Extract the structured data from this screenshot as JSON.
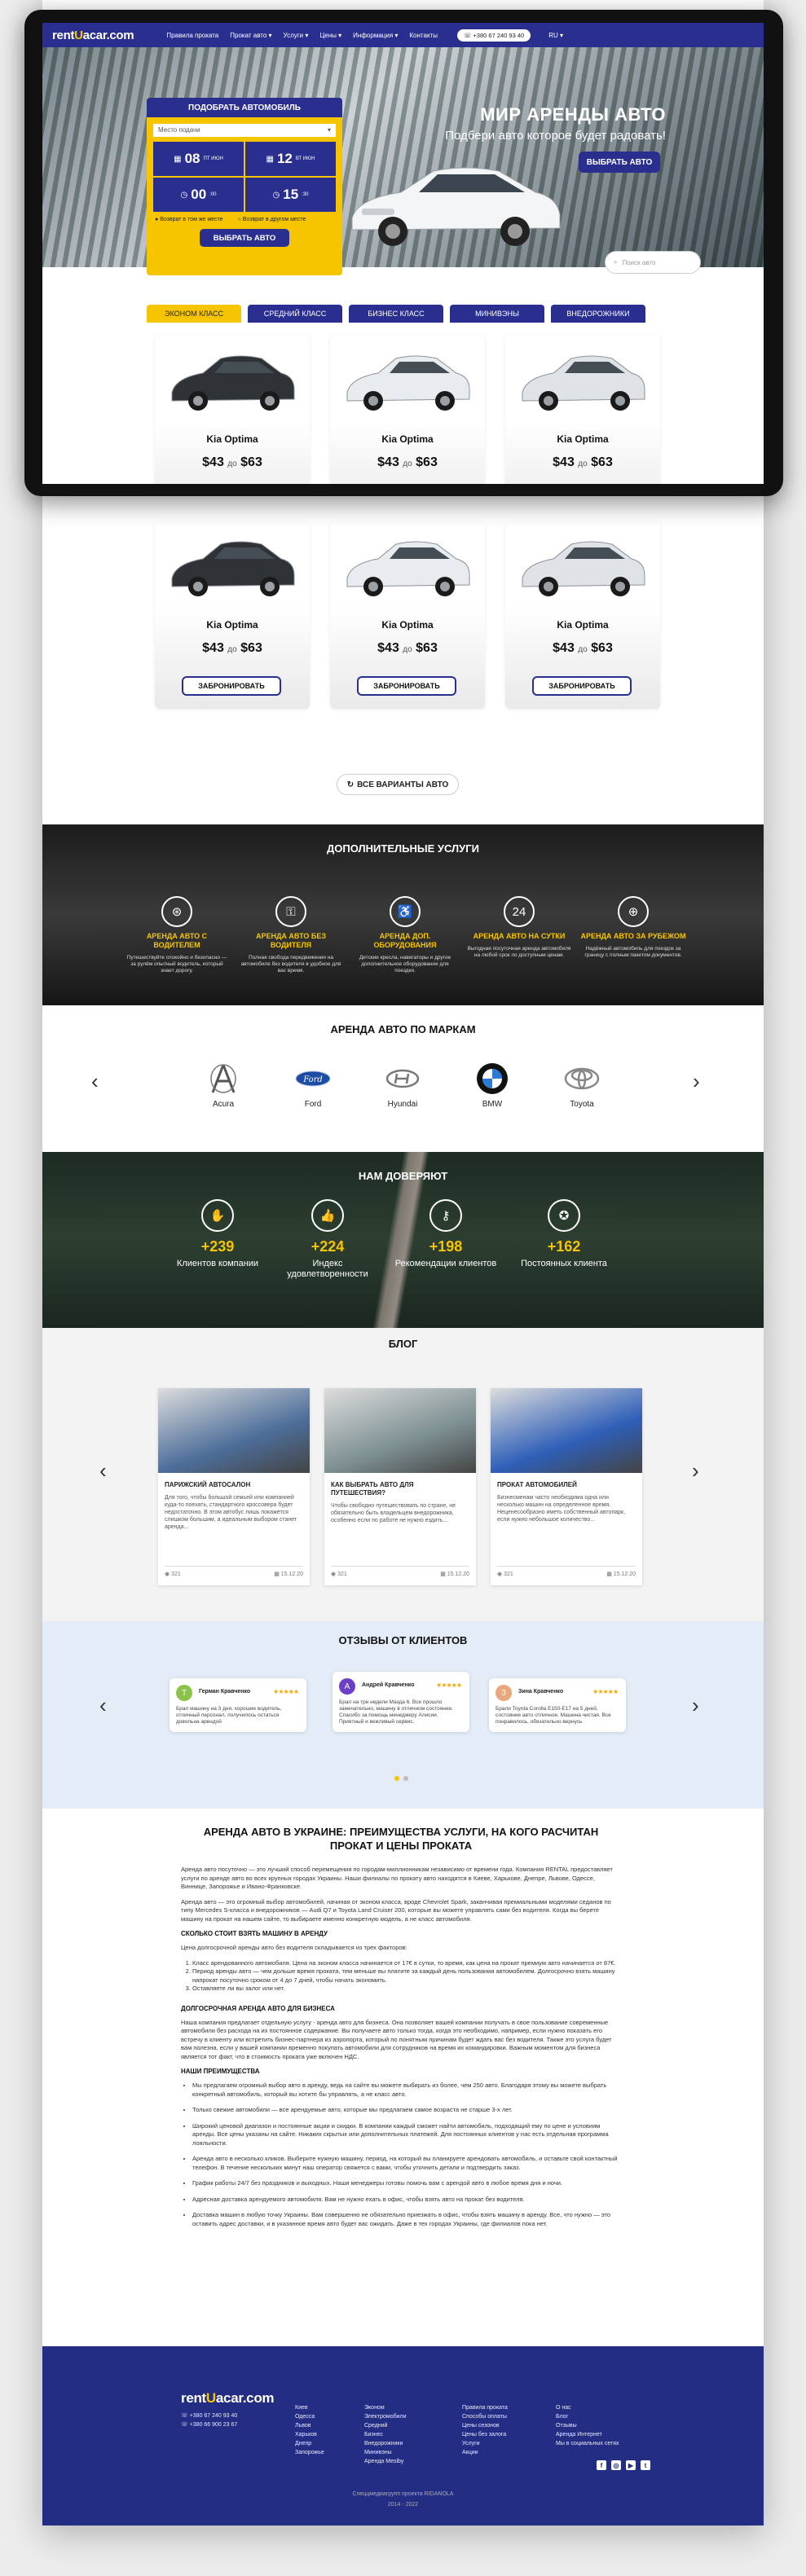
{
  "nav": {
    "logo_a": "rent",
    "logo_u": "U",
    "logo_b": "acar.com",
    "items": [
      "Правила проката",
      "Прокат авто ▾",
      "Услуги ▾",
      "Цены ▾",
      "Информация ▾",
      "Контакты"
    ],
    "phone": "+380 67 240 93 40",
    "lang": "RU ▾"
  },
  "hero": {
    "title": "МИР АРЕНДЫ АВТО",
    "subtitle": "Подбери авто которое будет радовать!",
    "cta": "ВЫБРАТЬ АВТО"
  },
  "form": {
    "title": "ПОДОБРАТЬ АВТОМОБИЛЬ",
    "place_placeholder": "Место подачи",
    "day1": "08",
    "day1_meta": "ПТ ИЮН",
    "day2": "12",
    "day2_meta": "ВТ ИЮН",
    "time1_h": "00",
    "time1_m": ":00",
    "time2_h": "15",
    "time2_m": ":30",
    "check1": "Возврат в том же месте",
    "check2": "Возврат в другом месте",
    "submit": "ВЫБРАТЬ АВТО"
  },
  "search": {
    "placeholder": "Поиск авто"
  },
  "tabs": [
    "ЭКОНОМ КЛАСС",
    "СРЕДНИЙ КЛАСС",
    "БИЗНЕС КЛАСС",
    "МИНИВЭНЫ",
    "ВНЕДОРОЖНИКИ"
  ],
  "cars": [
    {
      "name": "Kia Optima",
      "price_from": "$43",
      "price_sep": "до",
      "price_to": "$63",
      "book": "ЗАБРОНИРОВАТЬ",
      "color": "#2f3338"
    },
    {
      "name": "Kia Optima",
      "price_from": "$43",
      "price_sep": "до",
      "price_to": "$63",
      "book": "ЗАБРОНИРОВАТЬ",
      "color": "#e9ecef"
    },
    {
      "name": "Kia Optima",
      "price_from": "$43",
      "price_sep": "до",
      "price_to": "$63",
      "book": "ЗАБРОНИРОВАТЬ",
      "color": "#dfe2e6"
    },
    {
      "name": "Kia Optima",
      "price_from": "$43",
      "price_sep": "до",
      "price_to": "$63",
      "book": "ЗАБРОНИРОВАТЬ",
      "color": "#2f3338"
    },
    {
      "name": "Kia Optima",
      "price_from": "$43",
      "price_sep": "до",
      "price_to": "$63",
      "book": "ЗАБРОНИРОВАТЬ",
      "color": "#e9ecef"
    },
    {
      "name": "Kia Optima",
      "price_from": "$43",
      "price_sep": "до",
      "price_to": "$63",
      "book": "ЗАБРОНИРОВАТЬ",
      "color": "#dfe2e6"
    }
  ],
  "all_cars": "ВСЕ ВАРИАНТЫ АВТО",
  "services": {
    "title": "ДОПОЛНИТЕЛЬНЫЕ УСЛУГИ",
    "items": [
      {
        "title": "АРЕНДА АВТО С ВОДИТЕЛЕМ",
        "desc": "Путешествуйте спокойно и безопасно — за рулём опытный водитель, который знает дорогу.",
        "icon": "steering-wheel-icon"
      },
      {
        "title": "АРЕНДА АВТО БЕЗ ВОДИТЕЛЯ",
        "desc": "Полная свобода передвижения на автомобиле без водителя в удобное для вас время.",
        "icon": "car-key-icon"
      },
      {
        "title": "АРЕНДА ДОП. ОБОРУДОВАНИЯ",
        "desc": "Детские кресла, навигаторы и другое дополнительное оборудование для поездки.",
        "icon": "child-seat-icon"
      },
      {
        "title": "АРЕНДА АВТО НА СУТКИ",
        "desc": "Выгодная посуточная аренда автомобиля на любой срок по доступным ценам.",
        "icon": "car-24h-icon"
      },
      {
        "title": "АРЕНДА АВТО ЗА РУБЕЖОМ",
        "desc": "Надёжный автомобиль для поездок за границу с полным пакетом документов.",
        "icon": "globe-car-icon"
      }
    ]
  },
  "brands": {
    "title": "АРЕНДА АВТО ПО МАРКАМ",
    "items": [
      "Acura",
      "Ford",
      "Hyundai",
      "BMW",
      "Toyota"
    ]
  },
  "trust": {
    "title": "НАМ ДОВЕРЯЮТ",
    "items": [
      {
        "num": "+239",
        "label": "Клиентов компании",
        "icon": "handshake-icon"
      },
      {
        "num": "+224",
        "label": "Индекс удовлетворенности",
        "icon": "thumb-icon"
      },
      {
        "num": "+198",
        "label": "Рекомендации клиентов",
        "icon": "key-icon"
      },
      {
        "num": "+162",
        "label": "Постоянных клиента",
        "icon": "medal-icon"
      }
    ]
  },
  "blog": {
    "title": "БЛОГ",
    "posts": [
      {
        "title": "ПАРИЖСКИЙ АВТОСАЛОН",
        "desc": "Для того, чтобы большой семьей или компанией куда-то поехать, стандартного кроссовера будет недостаточно. В этом автобус лишь покажется слишком большим, а идеальным выбором станет аренда...",
        "views": "321",
        "date": "15.12.20",
        "img": "#4d6e9a"
      },
      {
        "title": "КАК ВЫБРАТЬ АВТО ДЛЯ ПУТЕШЕСТВИЯ?",
        "desc": "Чтобы свободно путешествовать по стране, не обязательно быть владельцем внедорожника, особенно если по работе не нужно ездить...",
        "views": "321",
        "date": "15.12.20",
        "img": "#7d8f92"
      },
      {
        "title": "ПРОКАТ АВТОМОБИЛЕЙ",
        "desc": "Бизнесменам часто необходима одна или несколько машин на определенное время. Неценесообразно иметь собственный автопарк, если нужно небольшое количество...",
        "views": "321",
        "date": "15.12.20",
        "img": "#2f5fb8"
      }
    ]
  },
  "reviews": {
    "title": "ОТЗЫВЫ ОТ КЛИЕНТОВ",
    "items": [
      {
        "initial": "T",
        "name": "Герман Кравченко",
        "stars": "★★★★★",
        "text": "Брал машину на 3 дня, хорошие водитель, отличный персонал, получилось остаться довольна арендой",
        "color": "#8bc34a"
      },
      {
        "initial": "A",
        "name": "Андрей Кравченко",
        "stars": "★★★★★",
        "text": "Брал на три недели Мазда 6. Все прошло замечательно, машину в отличном состоянии. Спасибо за помощь менеджеру Алисии. Приятный и вежливый сервис.",
        "color": "#6b3fc7"
      },
      {
        "initial": "З",
        "name": "Зина Кравченко",
        "stars": "★★★★★",
        "text": "Брали Toyota Corolla E150-E17 на 5 дней, состояние авто отличное. Машина чистая. Все понравилось, обязательно вернусь",
        "color": "#e8a87c"
      }
    ]
  },
  "article": {
    "title": "АРЕНДА АВТО В УКРАИНЕ: ПРЕИМУЩЕСТВА УСЛУГИ, НА КОГО РАСЧИТАН ПРОКАТ И ЦЕНЫ ПРОКАТА",
    "p1": "Аренда авто посуточно — это лучший способ перемещения по городам-миллионникам независимо от времени года. Компания RENTAL предоставляет услуги по аренде авто во всех крупных городах Украины. Наши филиалы по прокату авто находятся в Киеве, Харькове, Днепре, Львове, Одессе, Виннице, Запорожье и Ивано-Франковске.",
    "p2": "Аренда авто — это огромный выбор автомобилей, начиная от эконом класса, вроде Chevrolet Spark, заканчивая премиальными моделями седанов по типу Mercedes S-класса и внедорожников — Audi Q7 и Toyota Land Cruiser 200, которые вы можете управлять сами без водителя. Когда вы берете машину на прокат на нашем сайте, то выбираете именно конкретную модель, а не класс автомобиля.",
    "h1": "СКОЛЬКО СТОИТ ВЗЯТЬ МАШИНУ В АРЕНДУ",
    "p3": "Цена долгосрочной аренды авто без водителя складывается из трех факторов:",
    "ol": [
      "Класс арендованного автомобиля. Цена на эконом класса начинается от 17€ в сутки, то время, как цена на прокат премиум авто начинается от 87€.",
      "Период аренды авто — чем дольше время проката, тем меньше вы платите за каждый день пользования автомобилем. Долгосрочно взять машину напрокат посуточно сроком от 4 до 7 дней, чтобы начать экономить.",
      "Оставляете ли вы залог или нет."
    ],
    "h2": "ДОЛГОСРОЧНАЯ АРЕНДА АВТО ДЛЯ БИЗНЕСА",
    "p4": "Наша компания предлагает отдельную услугу - аренда авто для бизнеса. Она позволяет вашей компании получать в свое пользование современные автомобили без расхода на их постоянное содержание. Вы получаете авто только тогда, когда это необходимо, например, если нужно показать его встречу в клиенту или встретить бизнес-партнера из аэропорта, который по понятным причинам будет ждать вас без водителя. Также это услуга будет вам полезна, если у вашей компании временно покупать автомобили для сотрудников на время их командировки. Важным моментом для бизнеса является тот факт, что в стоимость проката уже включен НДС.",
    "h3": "НАШИ ПРЕИМУЩЕСТВА",
    "ul": [
      "Мы предлагаем огромный выбор авто в аренду, ведь на сайте вы можете выбирать из более, чем 250 авто. Благодаря этому вы можете выбрать конкретный автомобиль, который вы хотите бы управлять, а не класс авто.",
      "Только свежие автомобили — все арендуемые авто, которые мы предлагаем самое возраста не старше 3-х лет.",
      "Широкий ценовой диапазон и постоянные акции и скидки. В компании каждый сможет найти автомобиль, подходящий ему по цене и условиям аренды. Все цены указаны на сайте. Никаких скрытых или дополнительных платежей. Для постоянных клиентов у нас есть отдельная программа лояльности.",
      "Аренда авто в несколько кликов. Выберите нужную машину, период, на который вы планируете арендовать автомобиль, и оставьте свой контактный телефон. В течение нескольких минут наш оператор свяжется с вами, чтобы уточнить детали и подтвердить заказ.",
      "График работы 24/7 без праздников и выходных. Наши менеджеры готовы помочь вам с арендой авто в любое время дня и ночи.",
      "Адресная доставка арендуемого автомобиля. Вам не нужно ехать в офис, чтобы взять авто на прокат без водителя.",
      "Доставка машин в любую точку Украины. Вам совершенно не обязательно приезжать в офис, чтобы взять машину в аренду. Все, что нужно — это оставить адрес доставки, и в указанное время авто будет вас ожидать. Даже в тех городах Украины, где филиалов пока нет."
    ]
  },
  "footer": {
    "phone1": "+380 67 240 93 40",
    "phone2": "+380 66 900 23 67",
    "col1": [
      "Киев",
      "Одесса",
      "Львов",
      "Харьков",
      "Днепр",
      "Запорожье"
    ],
    "col2": [
      "Эконом",
      "Электромобили",
      "Средний",
      "Бизнес",
      "Внедорожники",
      "Минивэны",
      "Аренда Mesiby"
    ],
    "col3": [
      "Правила проката",
      "Способы оплаты",
      "Цены сезонов",
      "Цены без залога",
      "Услуги",
      "Акции"
    ],
    "col4": [
      "О нас",
      "Блог",
      "Отзывы",
      "Аренда Интернет",
      "Мы в социальных сетях"
    ],
    "copy1": "Спеццмедиагрупп проекта RIDANOLA",
    "copy2": "2014 - 2022"
  }
}
